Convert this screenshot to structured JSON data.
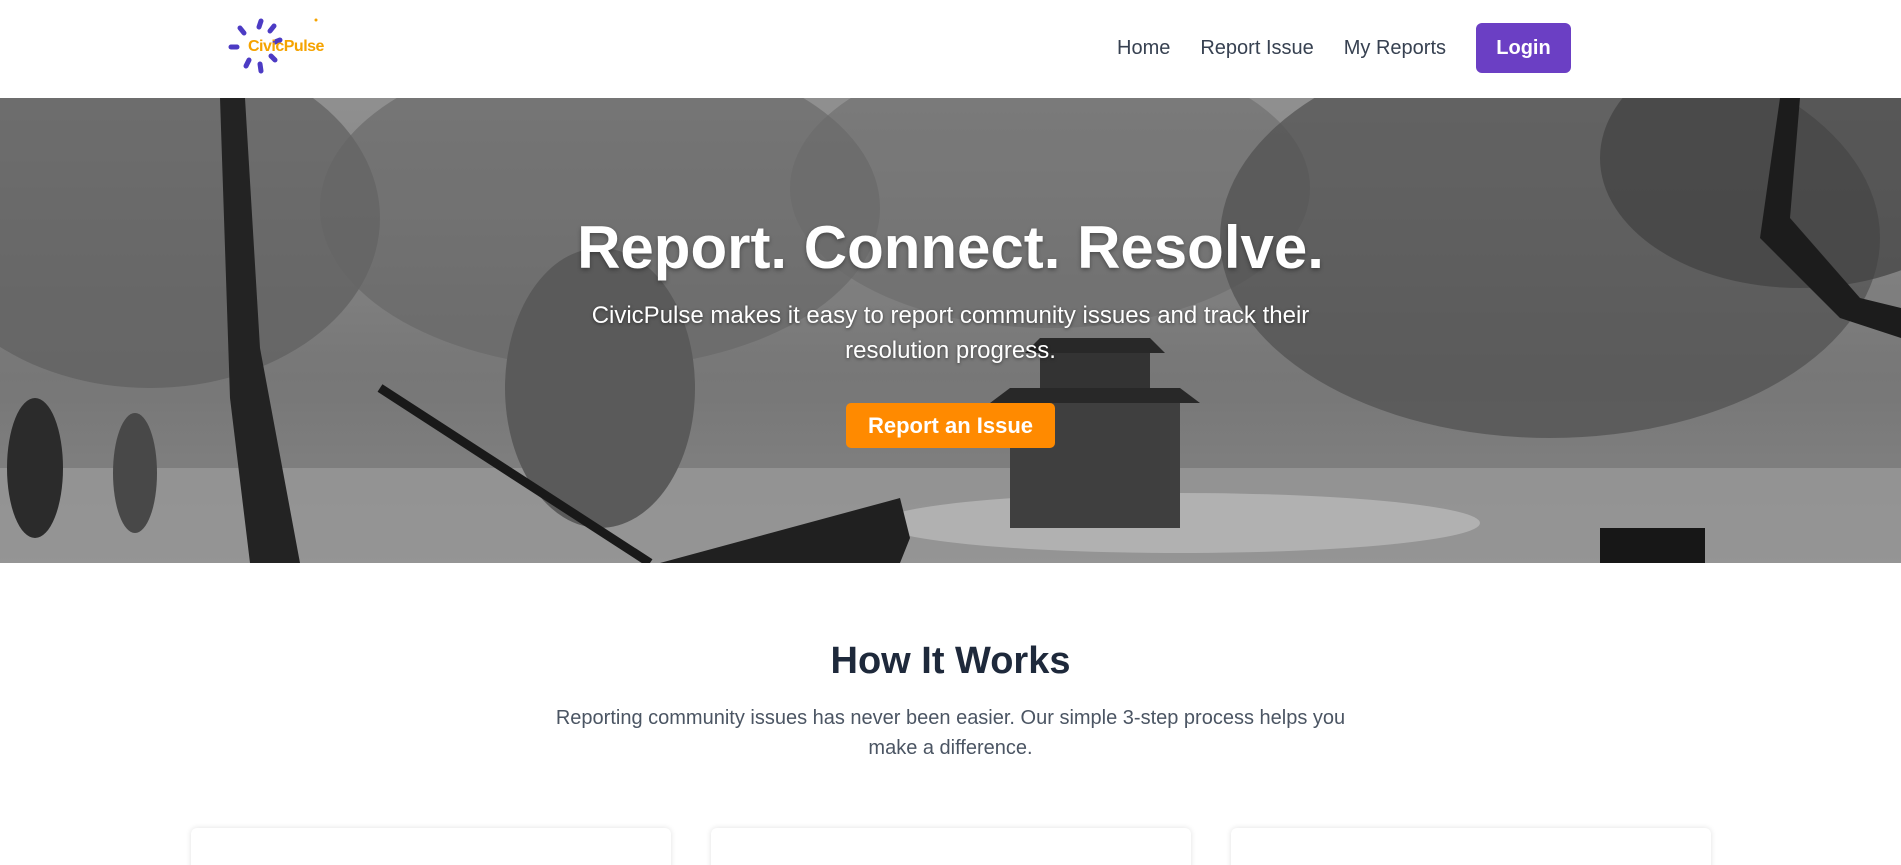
{
  "brand": {
    "name": "CivicPulse",
    "logo_color": "#f5a300",
    "icon_color": "#4c3bc4"
  },
  "nav": {
    "items": [
      {
        "label": "Home"
      },
      {
        "label": "Report Issue"
      },
      {
        "label": "My Reports"
      }
    ],
    "login_label": "Login"
  },
  "hero": {
    "title": "Report. Connect. Resolve.",
    "subtitle": "CivicPulse makes it easy to report community issues and track their resolution progress.",
    "cta_label": "Report an Issue",
    "cta_color": "#ff8a00"
  },
  "how_it_works": {
    "title": "How It Works",
    "subtitle": "Reporting community issues has never been easier. Our simple 3-step process helps you make a difference."
  },
  "colors": {
    "accent_purple": "#6b3fc4",
    "accent_orange": "#ff8a00"
  }
}
